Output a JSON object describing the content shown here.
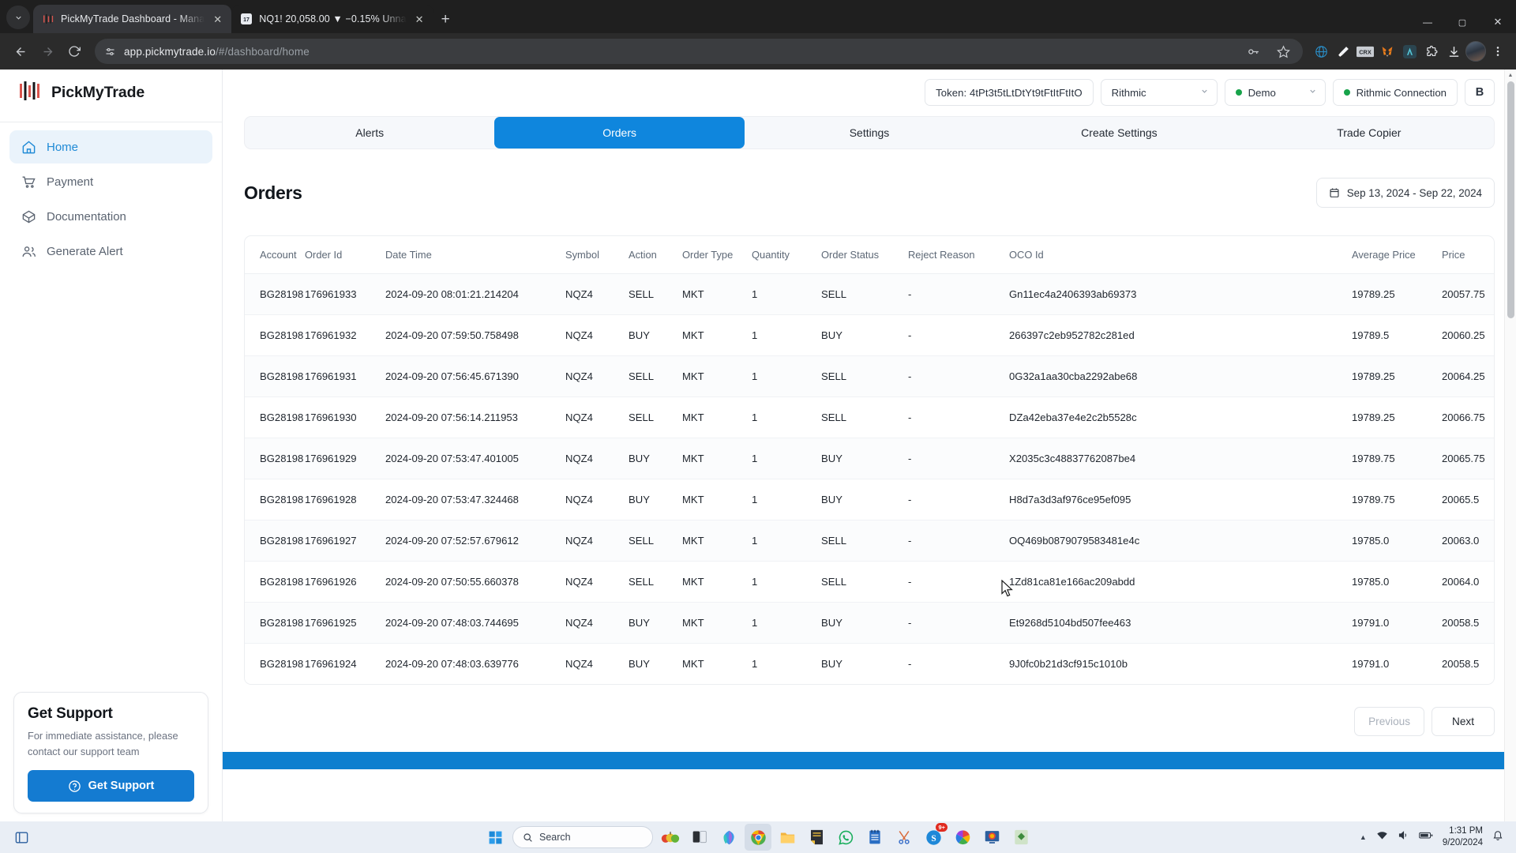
{
  "browser": {
    "tabs": [
      {
        "title": "PickMyTrade Dashboard - Mana",
        "favicon": "pickmytrade-logo-icon",
        "active": true
      },
      {
        "title": "NQ1! 20,058.00 ▼ −0.15% Unna",
        "favicon": "tradingview-icon",
        "active": false
      }
    ],
    "new_tab_label": "+",
    "tab_search_icon": "chevron-down-icon",
    "back_icon": "arrow-left-icon",
    "forward_icon": "arrow-right-icon",
    "reload_icon": "reload-icon",
    "site_info_icon": "site-settings-icon",
    "url_main": "app.pickmytrade.io",
    "url_path": "/#/dashboard/home",
    "toolbar_icons": [
      "password-key-icon",
      "bookmark-star-icon",
      "web3-extension-icon",
      "broom-extension-icon",
      "crx-extension-icon",
      "metamask-fox-icon",
      "teal-extension-icon",
      "extensions-puzzle-icon",
      "download-icon"
    ],
    "profile_icon": "profile-avatar",
    "menu_icon": "three-dot-menu-icon",
    "minimize_label": "—",
    "maximize_label": "▢",
    "close_label": "✕"
  },
  "sidebar": {
    "brand": "PickMyTrade",
    "brand_icon": "candlestick-logo-icon",
    "items": [
      {
        "label": "Home",
        "icon": "home-icon",
        "active": true
      },
      {
        "label": "Payment",
        "icon": "shopping-cart-icon",
        "active": false
      },
      {
        "label": "Documentation",
        "icon": "package-box-icon",
        "active": false
      },
      {
        "label": "Generate Alert",
        "icon": "users-icon",
        "active": false
      }
    ],
    "support": {
      "title": "Get Support",
      "description": "For immediate assistance, please contact our support team",
      "button_label": "Get Support",
      "button_icon": "question-circle-icon",
      "button_color": "#147bd1"
    }
  },
  "topbar": {
    "token_label": "Token: 4tPt3t5tLtDtYt9tFtItFtItO",
    "broker_select": {
      "value": "Rithmic",
      "icon": "chevron-down-icon"
    },
    "environment_select": {
      "value": "Demo",
      "status_color": "#17a34a",
      "icon": "chevron-down-icon"
    },
    "connection_status": {
      "label": "Rithmic Connection",
      "status_color": "#17a34a"
    },
    "user_badge": "B"
  },
  "tabs": {
    "items": [
      {
        "label": "Alerts",
        "active": false
      },
      {
        "label": "Orders",
        "active": true
      },
      {
        "label": "Settings",
        "active": false
      },
      {
        "label": "Create Settings",
        "active": false
      },
      {
        "label": "Trade Copier",
        "active": false
      }
    ],
    "active_color": "#0f86dd"
  },
  "page": {
    "title": "Orders",
    "date_range": "Sep 13, 2024 - Sep 22, 2024",
    "calendar_icon": "calendar-icon"
  },
  "table": {
    "columns": [
      "Account",
      "Order Id",
      "Date Time",
      "Symbol",
      "Action",
      "Order Type",
      "Quantity",
      "Order Status",
      "Reject Reason",
      "OCO Id",
      "Average Price",
      "Price"
    ],
    "rows": [
      [
        "BG28198",
        "176961933",
        "2024-09-20 08:01:21.214204",
        "NQZ4",
        "SELL",
        "MKT",
        "1",
        "SELL",
        "-",
        "Gn11ec4a2406393ab69373",
        "19789.25",
        "20057.75"
      ],
      [
        "BG28198",
        "176961932",
        "2024-09-20 07:59:50.758498",
        "NQZ4",
        "BUY",
        "MKT",
        "1",
        "BUY",
        "-",
        "266397c2eb952782c281ed",
        "19789.5",
        "20060.25"
      ],
      [
        "BG28198",
        "176961931",
        "2024-09-20 07:56:45.671390",
        "NQZ4",
        "SELL",
        "MKT",
        "1",
        "SELL",
        "-",
        "0G32a1aa30cba2292abe68",
        "19789.25",
        "20064.25"
      ],
      [
        "BG28198",
        "176961930",
        "2024-09-20 07:56:14.211953",
        "NQZ4",
        "SELL",
        "MKT",
        "1",
        "SELL",
        "-",
        "DZa42eba37e4e2c2b5528c",
        "19789.25",
        "20066.75"
      ],
      [
        "BG28198",
        "176961929",
        "2024-09-20 07:53:47.401005",
        "NQZ4",
        "BUY",
        "MKT",
        "1",
        "BUY",
        "-",
        "X2035c3c48837762087be4",
        "19789.75",
        "20065.75"
      ],
      [
        "BG28198",
        "176961928",
        "2024-09-20 07:53:47.324468",
        "NQZ4",
        "BUY",
        "MKT",
        "1",
        "BUY",
        "-",
        "H8d7a3d3af976ce95ef095",
        "19789.75",
        "20065.5"
      ],
      [
        "BG28198",
        "176961927",
        "2024-09-20 07:52:57.679612",
        "NQZ4",
        "SELL",
        "MKT",
        "1",
        "SELL",
        "-",
        "OQ469b0879079583481e4c",
        "19785.0",
        "20063.0"
      ],
      [
        "BG28198",
        "176961926",
        "2024-09-20 07:50:55.660378",
        "NQZ4",
        "SELL",
        "MKT",
        "1",
        "SELL",
        "-",
        "1Zd81ca81e166ac209abdd",
        "19785.0",
        "20064.0"
      ],
      [
        "BG28198",
        "176961925",
        "2024-09-20 07:48:03.744695",
        "NQZ4",
        "BUY",
        "MKT",
        "1",
        "BUY",
        "-",
        "Et9268d5104bd507fee463",
        "19791.0",
        "20058.5"
      ],
      [
        "BG28198",
        "176961924",
        "2024-09-20 07:48:03.639776",
        "NQZ4",
        "BUY",
        "MKT",
        "1",
        "BUY",
        "-",
        "9J0fc0b21d3cf915c1010b",
        "19791.0",
        "20058.5"
      ]
    ]
  },
  "pagination": {
    "previous_label": "Previous",
    "next_label": "Next",
    "previous_disabled": true
  },
  "taskbar": {
    "start_icon": "windows-start-icon",
    "search_placeholder": "Search",
    "search_icon": "search-icon",
    "apps": [
      "fruits-icon",
      "task-view-icon",
      "copilot-icon",
      "chrome-icon",
      "file-explorer-icon",
      "notepad-icon",
      "whatsapp-icon",
      "notebook-icon",
      "snipping-tool-icon",
      "skype-icon",
      "photos-icon",
      "remote-desktop-icon",
      "green-app-icon"
    ],
    "skype_badge": "9+",
    "time": "1:31 PM",
    "date": "9/20/2024"
  }
}
